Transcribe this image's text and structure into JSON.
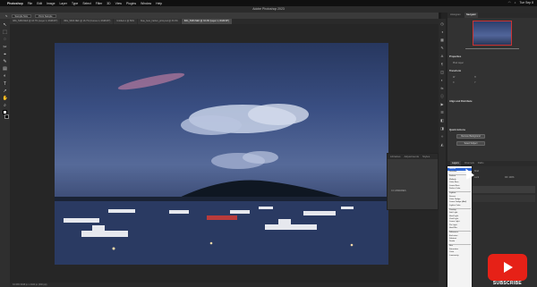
{
  "menubar": {
    "app": "Photoshop",
    "items": [
      "File",
      "Edit",
      "Image",
      "Layer",
      "Type",
      "Select",
      "Filter",
      "3D",
      "View",
      "Plugins",
      "Window",
      "Help"
    ],
    "clock": "Tue Sep 8"
  },
  "window": {
    "title": "Adobe Photoshop 2023"
  },
  "options": {
    "mode": "Sample Size",
    "value": "Point Sample"
  },
  "doc_tabs": [
    {
      "label": "IMG_5463.NEF @ 16.7% (Layer 1, RGB/16*)",
      "active": false
    },
    {
      "label": "IMG_5463.NEF @ 16.7% (Curves 1, RGB/16*)",
      "active": false
    },
    {
      "label": "Untitled-1 @ 50%",
      "active": false
    },
    {
      "label": "blue_hour_harbor_print.psd @ 33.3%",
      "active": false
    },
    {
      "label": "IMG_5463.NEF @ 33.3% (Layer 1, RGB/16*)",
      "active": true
    }
  ],
  "tools": [
    "↖",
    "⬚",
    "◌",
    "✂",
    "⌖",
    "✎",
    "▤",
    "◐",
    "T",
    "↗",
    "✋",
    "⌕"
  ],
  "status": "33.33%   6048 px x 4024 px (300 ppi)",
  "right_panel": {
    "tabs": [
      "Histogram",
      "Navigator"
    ],
    "active_tab": "Navigator",
    "properties_title": "Properties",
    "properties_sub": "Pixel Layer",
    "transform": "Transform",
    "transform_fields": [
      "W",
      "H",
      "X",
      "Y"
    ],
    "align": "Align and Distribute",
    "quick_actions": "Quick Actions",
    "remove_bg": "Remove Background",
    "select_subject": "Select Subject",
    "layers_tabs": [
      "Layers",
      "Channels",
      "Paths"
    ],
    "kind": "Kind",
    "lock": "Lock",
    "fill": "Fill: 100%"
  },
  "float_panel": {
    "tabs": [
      "Libraries",
      "Adjustments",
      "Styles"
    ],
    "note": "CC LIBRARIES"
  },
  "blend_modes": {
    "highlighted": "Normal",
    "items": [
      "Normal",
      "Dissolve",
      "-",
      "Darken",
      "Multiply",
      "Color Burn",
      "Linear Burn",
      "Darker Color",
      "-",
      "Lighten",
      "Screen",
      "Color Dodge",
      "Linear Dodge (Add)",
      "Lighter Color",
      "-",
      "Overlay",
      "Soft Light",
      "Hard Light",
      "Vivid Light",
      "Linear Light",
      "Pin Light",
      "Hard Mix",
      "-",
      "Difference",
      "Exclusion",
      "Subtract",
      "Divide",
      "-",
      "Hue",
      "Saturation",
      "Color",
      "Luminosity"
    ]
  },
  "watermark": "SUBSCRIBE"
}
